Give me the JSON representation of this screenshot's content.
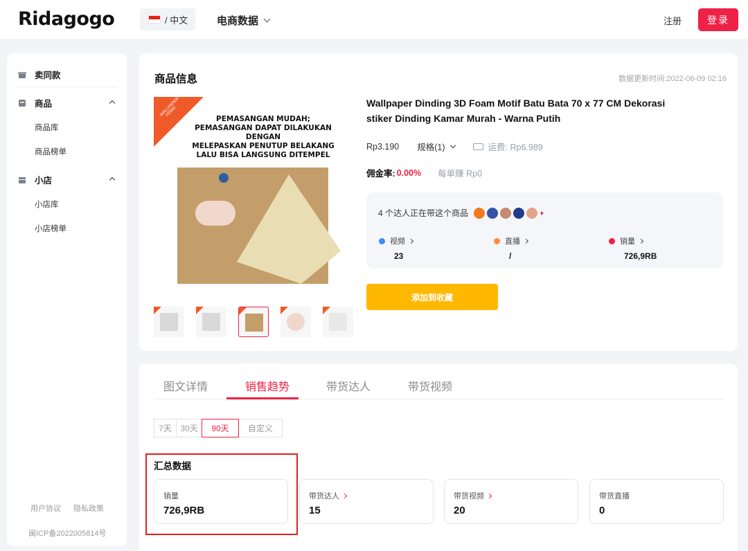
{
  "header": {
    "logo": "Ridagogo",
    "lang_label": "/ 中文",
    "nav_title": "电商数据",
    "register": "注册",
    "login": "登录"
  },
  "sidebar": {
    "items": [
      {
        "label": "卖同款"
      },
      {
        "label": "商品",
        "children": [
          "商品库",
          "商品榜单"
        ]
      },
      {
        "label": "小店",
        "children": [
          "小店库",
          "小店榜单"
        ]
      }
    ],
    "footer": {
      "user_agreement": "用户协议",
      "privacy": "隐私政策",
      "icp": "闽ICP备2022005814号"
    }
  },
  "product": {
    "section_title": "商品信息",
    "update_time": "数据更新时间:2022-06-09 02:16",
    "image_text": "PEMASANGAN MUDAH;\nPEMASANGAN DAPAT DILAKUKAN DENGAN\nMELEPASKAN PENUTUP BELAKANG\nLALU BISA LANGSUNG DITEMPEL",
    "image_tag": "WALLPAPER HOME",
    "name": "Wallpaper Dinding 3D Foam Motif Batu Bata 70 x 77 CM Dekorasi stiker Dinding Kamar Murah - Warna Putih",
    "price": "Rp3.190",
    "spec": "规格(1)",
    "shipping": "运费: Rp6.989",
    "commission_label": "佣金率:",
    "commission_value": "0.00%",
    "earn_per_order": "每单赚 Rp0",
    "creators_text": "4 个达人正在带这个商品",
    "stats": [
      {
        "label": "视频",
        "value": "23",
        "color": "#3b8cff"
      },
      {
        "label": "直播",
        "value": "/",
        "color": "#ff8a3d"
      },
      {
        "label": "销量",
        "value": "726,9RB",
        "color": "#ee2146"
      }
    ],
    "add_favorite": "添加到收藏"
  },
  "trend": {
    "tabs": [
      "图文详情",
      "销售趋势",
      "带货达人",
      "带货视频"
    ],
    "active_tab": "销售趋势",
    "ranges": [
      "7天",
      "30天",
      "90天",
      "自定义"
    ],
    "active_range": "90天",
    "summary_title": "汇总数据",
    "summary": [
      {
        "label": "销量",
        "value": "726,9RB",
        "link": false
      },
      {
        "label": "带货达人",
        "value": "15",
        "link": true
      },
      {
        "label": "带货视频",
        "value": "20",
        "link": true
      },
      {
        "label": "带货直播",
        "value": "0",
        "link": false
      }
    ]
  },
  "colors": {
    "accent": "#ee2146",
    "button": "#ffb800",
    "highlight": "#e0201b"
  }
}
